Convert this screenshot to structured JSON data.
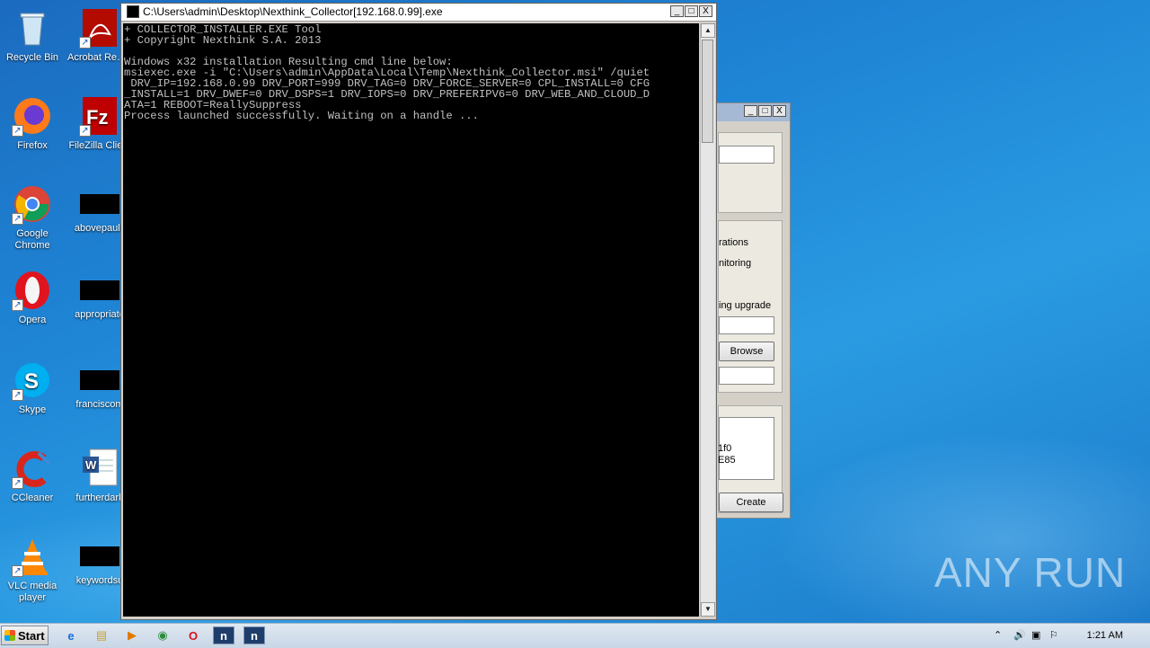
{
  "desktop_icons": [
    {
      "id": "recycle",
      "label": "Recycle Bin",
      "icon": "recycle-bin-icon"
    },
    {
      "id": "acrobat",
      "label": "Acrobat Reader DC",
      "icon": "acrobat-icon"
    },
    {
      "id": "firefox",
      "label": "Firefox",
      "icon": "firefox-icon"
    },
    {
      "id": "filezilla",
      "label": "FileZilla Client",
      "icon": "filezilla-icon"
    },
    {
      "id": "chrome",
      "label": "Google Chrome",
      "icon": "chrome-icon"
    },
    {
      "id": "abovepaul",
      "label": "abovepaul.j",
      "icon": "file-icon"
    },
    {
      "id": "opera",
      "label": "Opera",
      "icon": "opera-icon"
    },
    {
      "id": "appropriate",
      "label": "appropriate",
      "icon": "file-icon"
    },
    {
      "id": "skype",
      "label": "Skype",
      "icon": "skype-icon"
    },
    {
      "id": "franciscom",
      "label": "franciscom",
      "icon": "file-icon"
    },
    {
      "id": "ccleaner",
      "label": "CCleaner",
      "icon": "ccleaner-icon"
    },
    {
      "id": "furtherdark",
      "label": "furtherdark",
      "icon": "word-doc-icon"
    },
    {
      "id": "vlc",
      "label": "VLC media player",
      "icon": "vlc-icon"
    },
    {
      "id": "keywordsu",
      "label": "keywordsu",
      "icon": "file-icon"
    }
  ],
  "console": {
    "title": "C:\\Users\\admin\\Desktop\\Nexthink_Collector[192.168.0.99].exe",
    "lines": [
      "+ COLLECTOR_INSTALLER.EXE Tool",
      "+ Copyright Nexthink S.A. 2013",
      "",
      "Windows x32 installation Resulting cmd line below:",
      "msiexec.exe -i \"C:\\Users\\admin\\AppData\\Local\\Temp\\Nexthink_Collector.msi\" /quiet",
      " DRV_IP=192.168.0.99 DRV_PORT=999 DRV_TAG=0 DRV_FORCE_SERVER=0 CPL_INSTALL=0 CFG",
      "_INSTALL=1 DRV_DWEF=0 DRV_DSPS=1 DRV_IOPS=0 DRV_PREFERIPV6=0 DRV_WEB_AND_CLOUD_D",
      "ATA=1 REBOOT=ReallySuppress",
      "Process launched successfully. Waiting on a handle ..."
    ],
    "buttons": {
      "minimize": "_",
      "maximize": "□",
      "close": "X"
    }
  },
  "background_dialog": {
    "text_rations": "rations",
    "text_nitoring": "nitoring",
    "text_upgrade": "ing upgrade",
    "browse_label": "Browse",
    "id_line1": "1f0",
    "id_line2": "E85",
    "create_label": "Create"
  },
  "taskbar": {
    "start_label": "Start",
    "clock": "1:21 AM",
    "items": [
      {
        "name": "ie-icon",
        "glyph": "e"
      },
      {
        "name": "explorer-icon",
        "glyph": "▤"
      },
      {
        "name": "media-player-icon",
        "glyph": "▶"
      },
      {
        "name": "chrome-icon",
        "glyph": "◉"
      },
      {
        "name": "opera-icon",
        "glyph": "O"
      },
      {
        "name": "nexthink-icon",
        "glyph": "n"
      },
      {
        "name": "nexthink-icon",
        "glyph": "n"
      }
    ]
  },
  "watermark": "ANY RUN"
}
